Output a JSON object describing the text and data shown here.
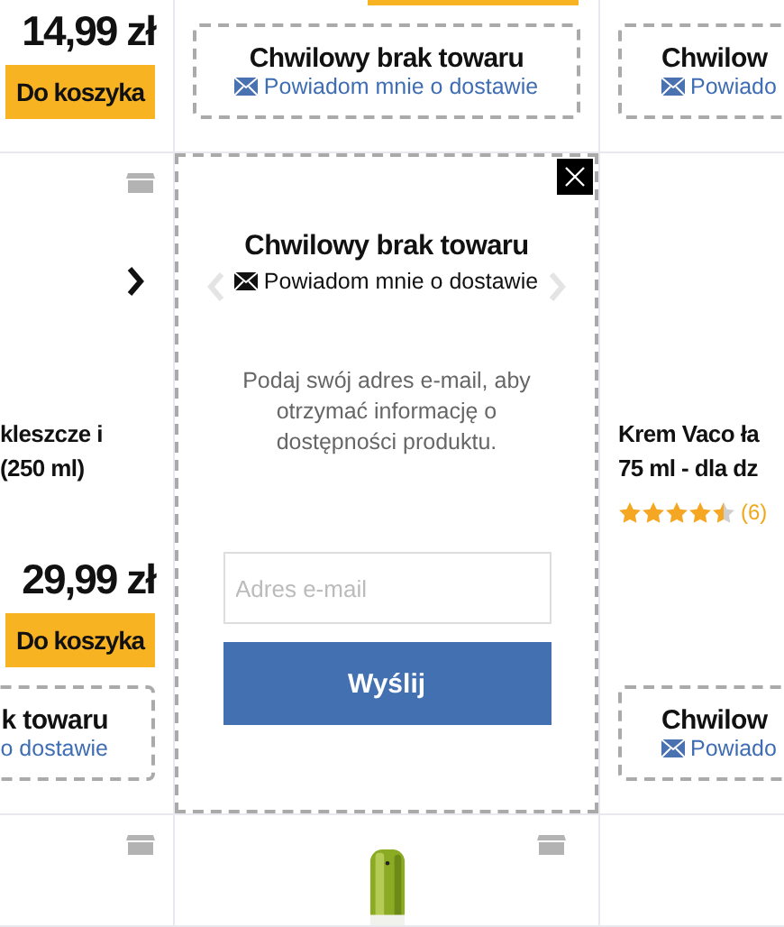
{
  "rows": [
    {
      "cells": [
        {
          "price": "14,99 zł",
          "cart_button": "Do koszyka"
        },
        {
          "cart_strip": true,
          "notice": {
            "title": "Chwilowy brak towaru",
            "link": "Powiadom mnie o dostawie"
          }
        },
        {
          "notice": {
            "title": "Chwilow",
            "link": "Powiado"
          }
        }
      ]
    },
    {
      "cells": [
        {
          "box_icon": true,
          "chevron": true,
          "title_lines": [
            "kleszcze i",
            "(250 ml)"
          ],
          "price": "29,99 zł",
          "cart_button": "Do koszyka",
          "notice": {
            "title": "k towaru",
            "link": "o dostawie"
          }
        },
        {
          "popup": {
            "title": "Chwilowy brak towaru",
            "link": "Powiadom mnie o dostawie",
            "text": "Podaj swój adres e-mail, aby otrzymać informację o dostępności produktu.",
            "placeholder": "Adres e-mail",
            "button": "Wyślij"
          }
        },
        {
          "title_lines": [
            "Krem Vaco ła",
            "75 ml - dla dz"
          ],
          "rating": {
            "stars": 4.5,
            "count": "(6)"
          },
          "notice": {
            "title": "Chwilow",
            "link": "Powiado"
          }
        }
      ]
    },
    {
      "cells": [
        {
          "box_icon": true
        },
        {
          "box_icon": true,
          "picture": true
        },
        {}
      ]
    }
  ]
}
